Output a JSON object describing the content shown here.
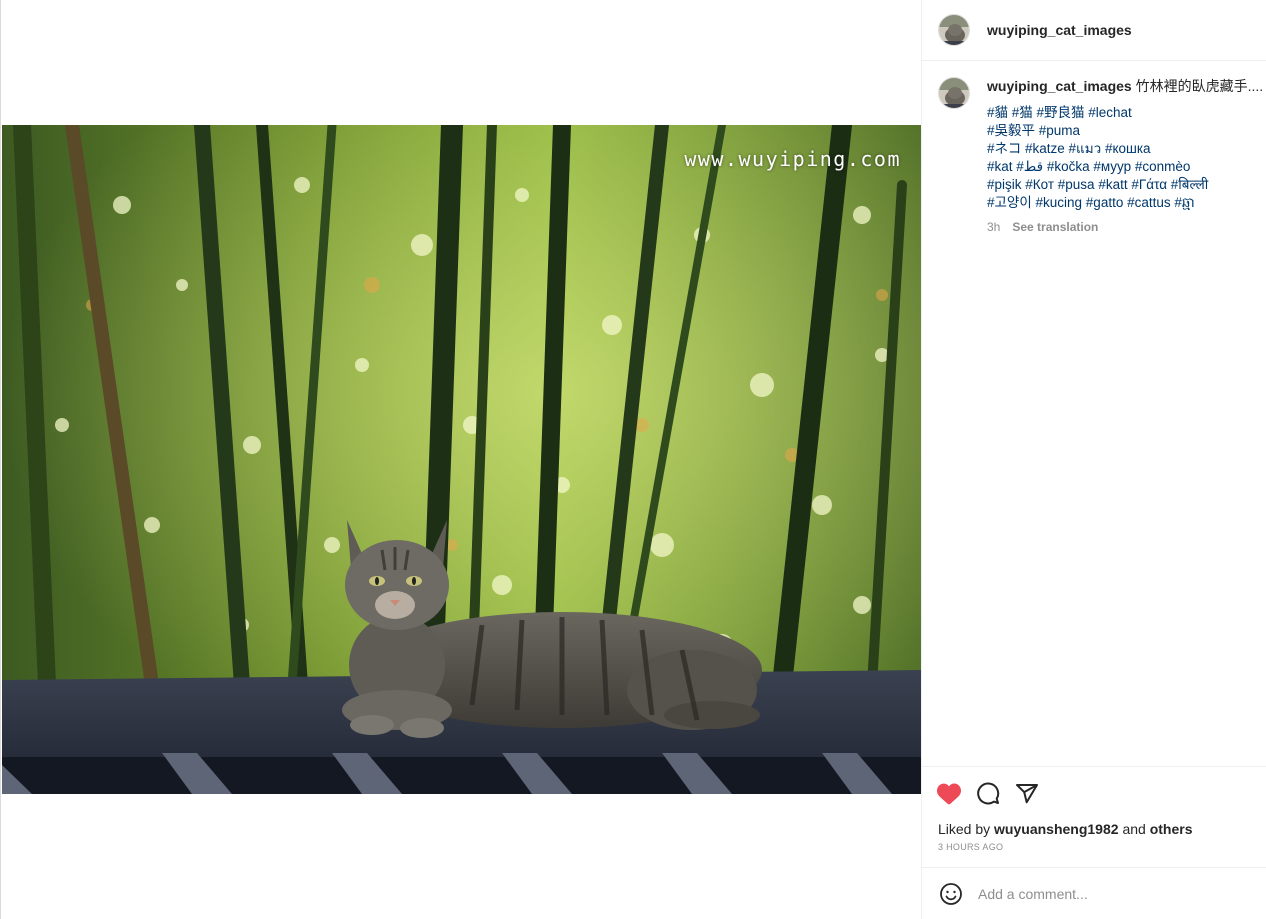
{
  "post": {
    "username": "wuyiping_cat_images",
    "watermark": "www.wuyiping.com",
    "caption_head": "竹林裡的臥虎藏手....",
    "hashtag_lines": [
      "#貓 #猫 #野良猫 #lechat",
      "#吳毅平 #puma",
      "#ネコ #katze #แมว #кошка",
      "#kat #قط #kočka #муур #conmèo",
      "#pişik #Кот #pusa #katt #Γάτα #बिल्ली",
      "#고양이 #kucing #gatto #cattus #ឆ្មា"
    ],
    "age": "3h",
    "see_translation": "See translation"
  },
  "likes": {
    "prefix": "Liked by",
    "user": "wuyuansheng1982",
    "and": "and",
    "others": "others",
    "timestamp": "3 HOURS AGO"
  },
  "comment": {
    "placeholder": "Add a comment..."
  },
  "icons": {
    "like": "heart-icon",
    "comment": "comment-icon",
    "share": "share-icon",
    "emoji": "emoji-icon"
  },
  "colors": {
    "like_red": "#ed4956",
    "hashtag_blue": "#00376b"
  }
}
